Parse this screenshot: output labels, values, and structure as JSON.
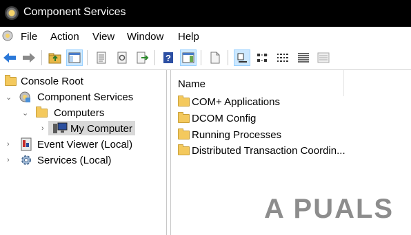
{
  "window": {
    "title": "Component Services"
  },
  "menu": {
    "items": [
      "File",
      "Action",
      "View",
      "Window",
      "Help"
    ]
  },
  "toolbar": {
    "buttons": [
      "back-arrow-icon",
      "forward-arrow-icon",
      "up-folder-icon",
      "show-hide-tree-icon",
      "export-list-icon",
      "refresh-icon",
      "export-icon",
      "help-icon",
      "action-pane-icon",
      "new-window-icon",
      "view-large-icon",
      "view-small-icon",
      "view-list-icon",
      "view-detail-icon",
      "view-custom-icon"
    ]
  },
  "tree": {
    "root": "Console Root",
    "component_services": "Component Services",
    "computers": "Computers",
    "my_computer": "My Computer",
    "event_viewer": "Event Viewer (Local)",
    "services": "Services (Local)"
  },
  "list": {
    "column_header": "Name",
    "items": [
      "COM+ Applications",
      "DCOM Config",
      "Running Processes",
      "Distributed Transaction Coordin..."
    ]
  },
  "watermark": "A PUALS",
  "colors": {
    "titlebar": "#000000",
    "folder": "#f4c95d",
    "selection": "#d9d9d9",
    "pressed": "#cce8ff"
  }
}
